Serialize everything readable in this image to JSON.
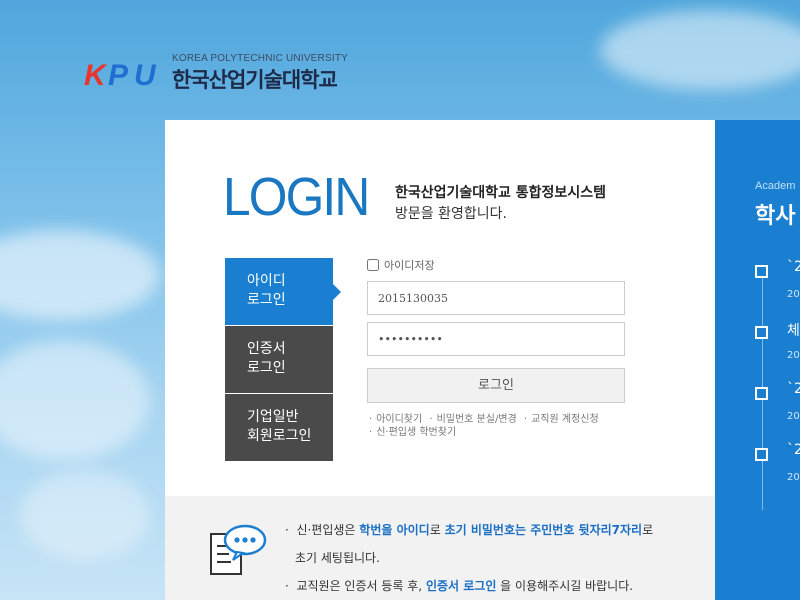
{
  "logo": {
    "mark": "KPU",
    "subtitle": "KOREA POLYTECHNIC UNIVERSITY",
    "title": "한국산업기술대학교"
  },
  "login": {
    "heading": "LOGIN",
    "welcome_line1": "한국산업기술대학교 통합정보시스템",
    "welcome_line2": "방문을 환영합니다."
  },
  "tabs": [
    {
      "line1": "아이디",
      "line2": "로그인"
    },
    {
      "line1": "인증서",
      "line2": "로그인"
    },
    {
      "line1": "기업일반",
      "line2": "회원로그인"
    }
  ],
  "form": {
    "save_id_label": "아이디저장",
    "id_value": "2015130035",
    "password_value": "••••••••••",
    "login_button": "로그인"
  },
  "links": {
    "find_id": "아이디찾기",
    "lost_password": "비밀번호 분실/변경",
    "staff_request": "교직원 계정신청",
    "freshman_find": "신·편입생 학번찾기"
  },
  "notice": {
    "n1_a": "신·편입생은 ",
    "n1_b": "학번을 아이디",
    "n1_c": "로 ",
    "n1_d": "초기 비밀번호는 주민번호 뒷자리7자리",
    "n1_e": "로",
    "n1_f": "초기 세팅됩니다.",
    "n2_a": "교직원은 인증서 등록 후, ",
    "n2_b": "인증서 로그인",
    "n2_c": " 을 이용해주시길 바랍니다."
  },
  "side": {
    "subtitle": "Academ",
    "title": "학사",
    "items": [
      {
        "title": "`2",
        "date": "202"
      },
      {
        "title": "체",
        "date": "202"
      },
      {
        "title": "`2",
        "date": "202"
      },
      {
        "title": "`2",
        "date": "202"
      }
    ]
  },
  "colors": {
    "accent": "#1a7fd0",
    "dark_tab": "#4a4a4a",
    "logo_red": "#e8352e",
    "logo_blue": "#1e6fd0"
  }
}
